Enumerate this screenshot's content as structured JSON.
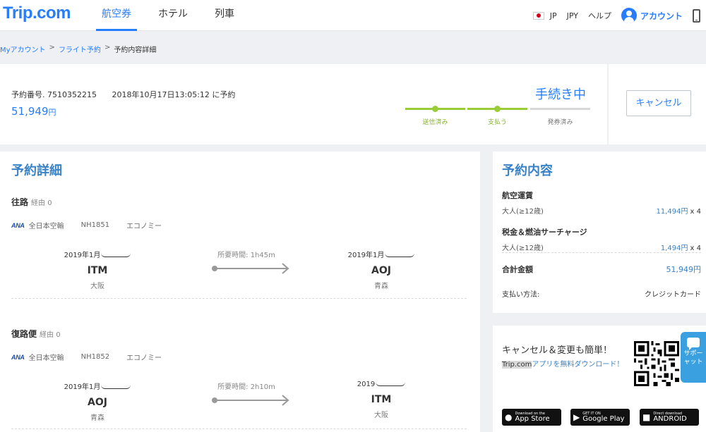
{
  "header": {
    "logo": "Trip.com",
    "nav": [
      "航空券",
      "ホテル",
      "列車"
    ],
    "lang": "JP",
    "currency": "JPY",
    "help": "ヘルプ",
    "account": "アカウント"
  },
  "breadcrumb": [
    "Myアカウント",
    "フライト予約",
    "予約内容詳細"
  ],
  "order": {
    "number_label": "予約番号.",
    "number": "7510352215",
    "booked_at": "2018年10月17日13:05:12 に予約",
    "total": "51,949",
    "yen": "円",
    "status": "手続き中",
    "steps": [
      {
        "label": "送信済み",
        "done": true
      },
      {
        "label": "支払う",
        "done": true
      },
      {
        "label": "発券済み",
        "done": false
      }
    ],
    "cancel_label": "キャンセル"
  },
  "details": {
    "title": "予約詳細",
    "duration_label": "所要時間:",
    "legs": [
      {
        "title": "往路",
        "stops": "経由 0",
        "airline_logo": "ANA",
        "airline": "全日本空輸",
        "flight_no": "NH1851",
        "cabin": "エコノミー",
        "dep_date": "2019年1月",
        "dep_code": "ITM",
        "dep_city": "大阪",
        "duration": "1h45m",
        "arr_date": "2019年1月",
        "arr_code": "AOJ",
        "arr_city": "青森"
      },
      {
        "title": "復路便",
        "stops": "経由 0",
        "airline_logo": "ANA",
        "airline": "全日本空輸",
        "flight_no": "NH1852",
        "cabin": "エコノミー",
        "dep_date": "2019年1月",
        "dep_code": "AOJ",
        "dep_city": "青森",
        "duration": "2h10m",
        "arr_date": "2019",
        "arr_code": "ITM",
        "arr_city": "大阪"
      }
    ]
  },
  "summary": {
    "title": "予約内容",
    "fare_label": "航空運賃",
    "fare_pax": "大人(≥12歳)",
    "fare_amount": "11,494円",
    "fare_qty": "x 4",
    "tax_label": "税金＆燃油サーチャージ",
    "tax_pax": "大人(≥12歳)",
    "tax_amount": "1,494円",
    "tax_qty": "x 4",
    "total_label": "合計金額",
    "total_value": "51,949円",
    "pay_label": "支払い方法:",
    "pay_value": "クレジットカード"
  },
  "promo": {
    "title": "キャンセル＆変更も簡単！",
    "sub_brand": "Trip.com",
    "sub_text": "アプリを無料ダウンロード！",
    "apple_small": "Download on the",
    "apple_big": "App Store",
    "google_small": "GET IT ON",
    "google_big": "Google Play",
    "android_small": "Direct download",
    "android_big": "ANDROID"
  },
  "support": {
    "label_1": "サポー",
    "label_2": "ャット"
  },
  "colors": {
    "brand": "#287dfa",
    "heading": "#3a82c6",
    "progress": "#9acc38"
  }
}
